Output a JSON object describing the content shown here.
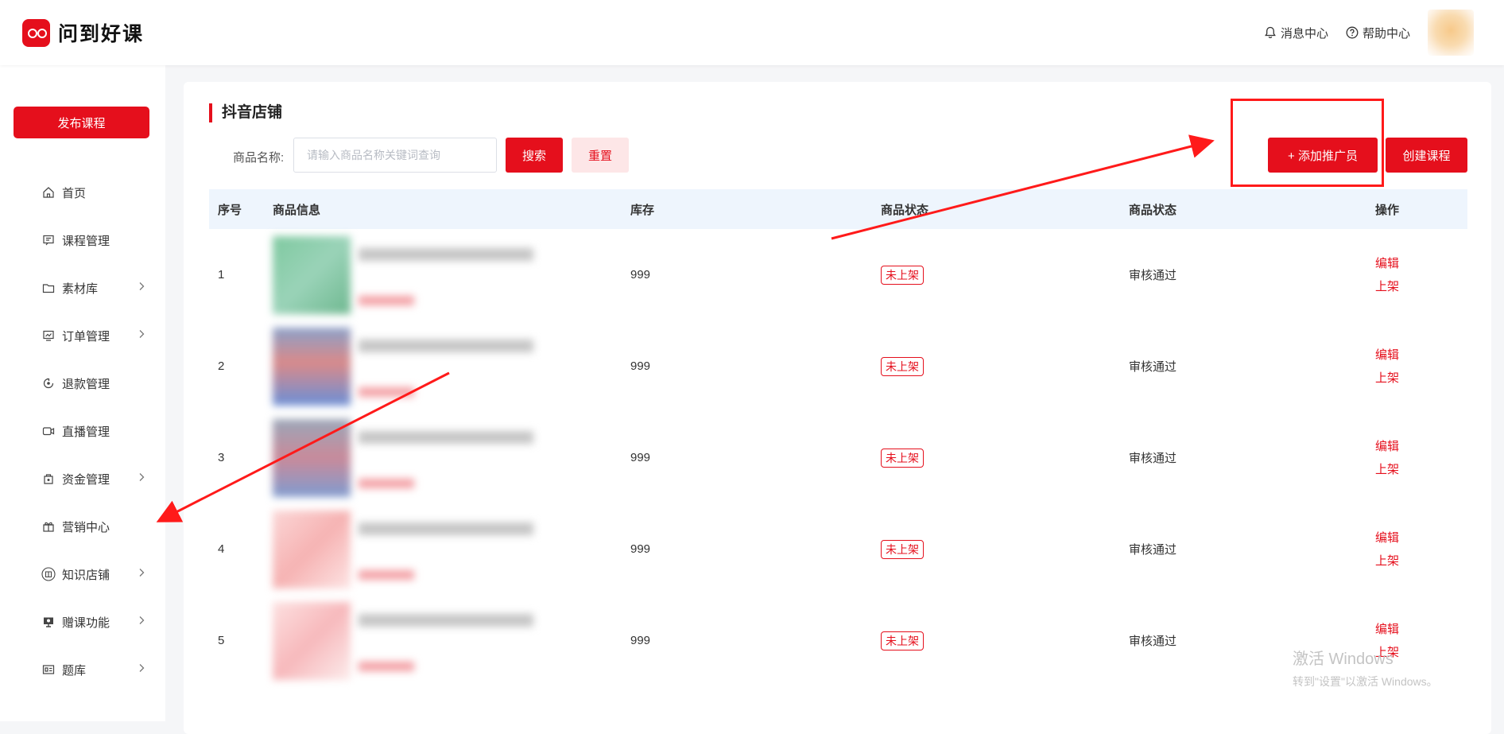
{
  "header": {
    "logo_text": "问到好课",
    "messages_label": "消息中心",
    "help_label": "帮助中心"
  },
  "sidebar": {
    "publish_label": "发布课程",
    "items": [
      {
        "label": "首页",
        "icon": "home-icon",
        "has_arrow": false
      },
      {
        "label": "课程管理",
        "icon": "course-icon",
        "has_arrow": false
      },
      {
        "label": "素材库",
        "icon": "folder-icon",
        "has_arrow": true
      },
      {
        "label": "订单管理",
        "icon": "order-icon",
        "has_arrow": true
      },
      {
        "label": "退款管理",
        "icon": "refund-icon",
        "has_arrow": false
      },
      {
        "label": "直播管理",
        "icon": "live-icon",
        "has_arrow": false
      },
      {
        "label": "资金管理",
        "icon": "wallet-icon",
        "has_arrow": true
      },
      {
        "label": "营销中心",
        "icon": "gift-icon",
        "has_arrow": false
      },
      {
        "label": "知识店铺",
        "icon": "shop-icon",
        "has_arrow": true
      },
      {
        "label": "赠课功能",
        "icon": "gift-course-icon",
        "has_arrow": true
      },
      {
        "label": "题库",
        "icon": "question-bank-icon",
        "has_arrow": true
      }
    ]
  },
  "main": {
    "title": "抖音店铺",
    "search_label": "商品名称:",
    "search_placeholder": "请输入商品名称关键词查询",
    "search_button": "搜索",
    "reset_button": "重置",
    "add_promoter_button": "+ 添加推广员",
    "create_course_button": "创建课程",
    "columns": [
      "序号",
      "商品信息",
      "库存",
      "商品状态",
      "商品状态",
      "操作"
    ],
    "rows": [
      {
        "index": "1",
        "stock": "999",
        "status": "未上架",
        "audit": "审核通过",
        "edit": "编辑",
        "list": "上架"
      },
      {
        "index": "2",
        "stock": "999",
        "status": "未上架",
        "audit": "审核通过",
        "edit": "编辑",
        "list": "上架"
      },
      {
        "index": "3",
        "stock": "999",
        "status": "未上架",
        "audit": "审核通过",
        "edit": "编辑",
        "list": "上架"
      },
      {
        "index": "4",
        "stock": "999",
        "status": "未上架",
        "audit": "审核通过",
        "edit": "编辑",
        "list": "上架"
      },
      {
        "index": "5",
        "stock": "999",
        "status": "未上架",
        "audit": "审核通过",
        "edit": "编辑",
        "list": "上架"
      }
    ]
  },
  "watermark": {
    "line1": "激活 Windows",
    "line2": "转到\"设置\"以激活 Windows。"
  },
  "colors": {
    "brand": "#e50f1c",
    "header_row_bg": "#eef5fd",
    "annotation": "#ff1a1a"
  }
}
